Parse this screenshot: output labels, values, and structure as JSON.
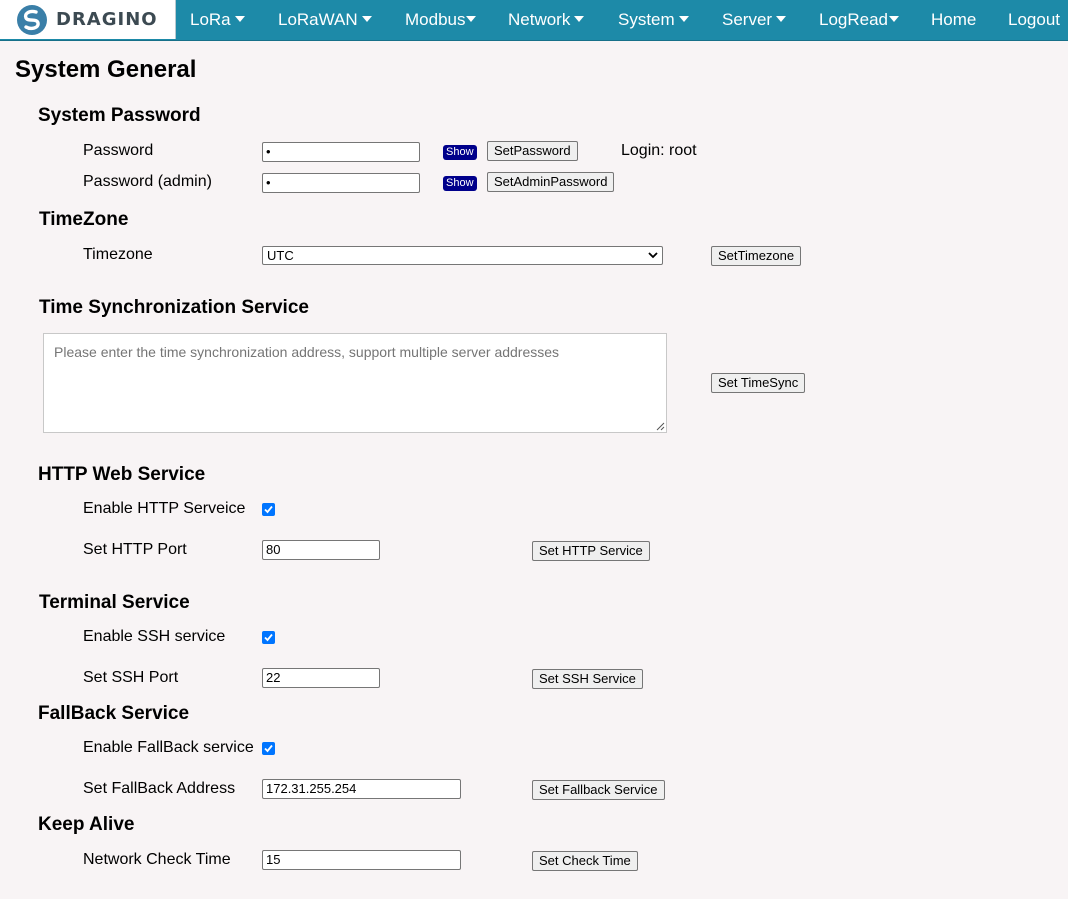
{
  "nav": {
    "logo_text": "DRAGINO",
    "items": [
      {
        "label": "LoRa",
        "dropdown": true
      },
      {
        "label": "LoRaWAN",
        "dropdown": true
      },
      {
        "label": "Modbus",
        "dropdown": true
      },
      {
        "label": "Network",
        "dropdown": true
      },
      {
        "label": "System",
        "dropdown": true
      },
      {
        "label": "Server",
        "dropdown": true
      },
      {
        "label": "LogRead",
        "dropdown": true
      },
      {
        "label": "Home",
        "dropdown": false
      },
      {
        "label": "Logout",
        "dropdown": false
      }
    ],
    "bar_color": "#1d8aa8"
  },
  "page_title": "System General",
  "password": {
    "heading": "System Password",
    "password_label": "Password",
    "password_value": "•",
    "show_label": "Show",
    "set_password_label": "SetPassword",
    "login_text": "Login: root",
    "admin_label": "Password (admin)",
    "admin_value": "•",
    "set_admin_label": "SetAdminPassword"
  },
  "timezone": {
    "heading": "TimeZone",
    "label": "Timezone",
    "selected": "UTC",
    "button": "SetTimezone"
  },
  "timesync": {
    "heading": "Time Synchronization Service",
    "placeholder": "Please enter the time synchronization address, support multiple server addresses",
    "button": "Set TimeSync"
  },
  "http": {
    "heading": "HTTP Web Service",
    "enable_label": "Enable HTTP Serveice",
    "enabled": true,
    "port_label": "Set HTTP Port",
    "port_value": "80",
    "button": "Set HTTP Service"
  },
  "terminal": {
    "heading": "Terminal Service",
    "enable_label": "Enable SSH service",
    "enabled": true,
    "port_label": "Set SSH Port",
    "port_value": "22",
    "button": "Set SSH Service"
  },
  "fallback": {
    "heading": "FallBack Service",
    "enable_label": "Enable FallBack service",
    "enabled": true,
    "address_label": "Set FallBack Address",
    "address_value": "172.31.255.254",
    "button": "Set Fallback Service"
  },
  "keepalive": {
    "heading": "Keep Alive",
    "label": "Network Check Time",
    "value": "15",
    "button": "Set Check Time"
  }
}
